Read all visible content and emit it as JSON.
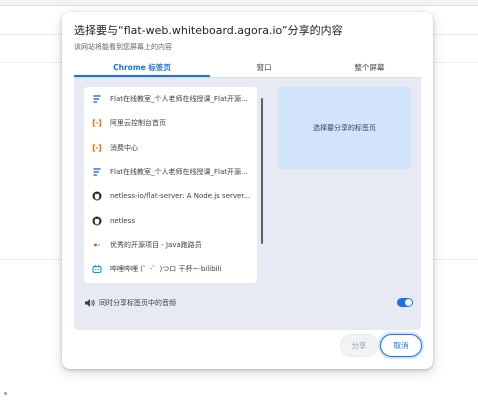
{
  "dialog": {
    "title": "选择要与“flat-web.whiteboard.agora.io”分享的内容",
    "subtitle": "该网站将能看到您屏幕上的内容"
  },
  "tabs": [
    {
      "label": "Chrome 标签页",
      "active": true
    },
    {
      "label": "窗口",
      "active": false
    },
    {
      "label": "整个屏幕",
      "active": false
    }
  ],
  "tab_list": [
    {
      "label": "Flat在线教室_个人老师在线授课_Flat开源...",
      "icon": "flat-favicon",
      "color": "#3a6cf4"
    },
    {
      "label": "阿里云控制台首页",
      "icon": "aliyun-favicon",
      "color": "#ff6a00"
    },
    {
      "label": "消费中心",
      "icon": "aliyun-favicon",
      "color": "#ff6a00"
    },
    {
      "label": "Flat在线教室_个人老师在线授课_Flat开源...",
      "icon": "flat-favicon",
      "color": "#3a6cf4"
    },
    {
      "label": "netless-io/flat-server: A Node.js server...",
      "icon": "github-favicon",
      "color": "#24292f"
    },
    {
      "label": "netless",
      "icon": "github-favicon",
      "color": "#24292f"
    },
    {
      "label": "优秀的开源项目 - Java跑路员",
      "icon": "dot-favicon",
      "color": "#e53935"
    },
    {
      "label": "哔哩哔哩 (゜-゜)つロ 干杯~-bilibili",
      "icon": "bilibili-favicon",
      "color": "#00a1d6"
    }
  ],
  "preview": {
    "label": "选择要分享的标签页"
  },
  "audio": {
    "label": "同时分享标签页中的音频",
    "enabled": true
  },
  "buttons": {
    "share": "分享",
    "cancel": "取消"
  },
  "colors": {
    "accent": "#1a73e8",
    "preview_bg": "#d2e3fc",
    "panel_bg": "#e8eaf3"
  }
}
